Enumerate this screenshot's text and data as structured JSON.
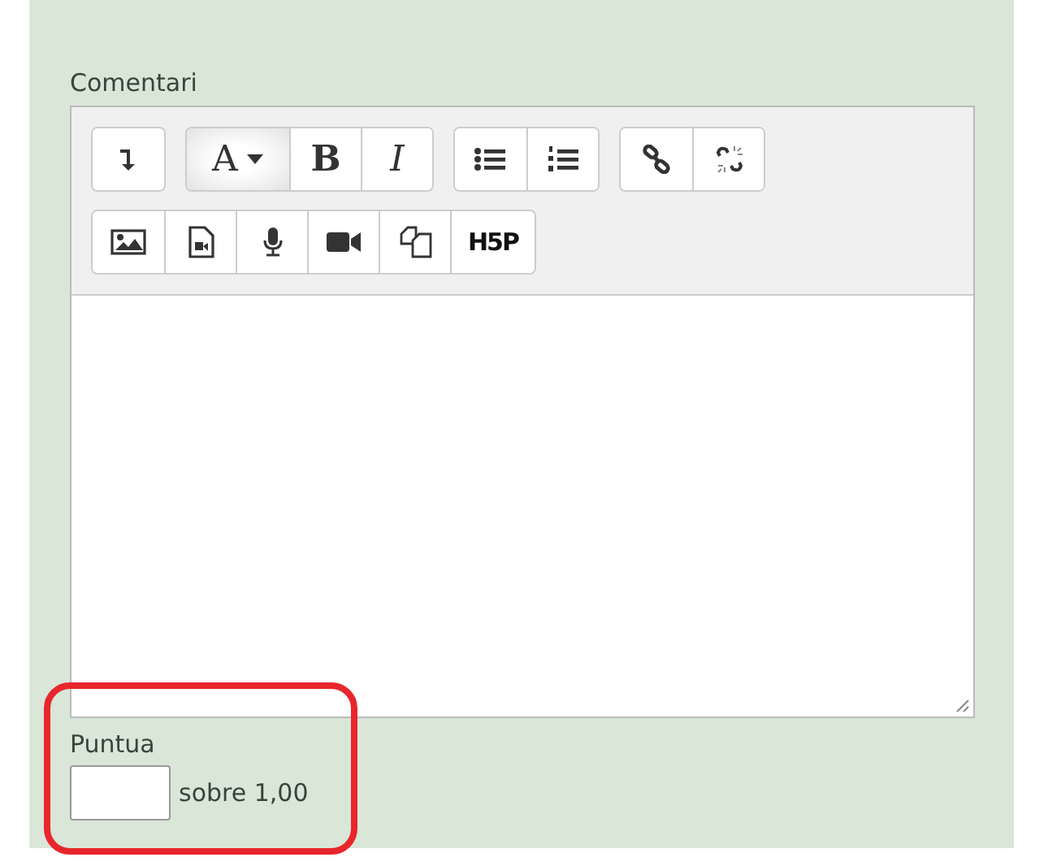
{
  "comment_field": {
    "label": "Comentari",
    "toolbar_rows": [
      [
        {
          "buttons": [
            {
              "kind": "icon",
              "selected": false
            }
          ]
        },
        {
          "buttons": [
            {
              "kind": "dropdown",
              "label": "A",
              "selected": true
            },
            {
              "kind": "bold",
              "label": "B",
              "selected": false
            },
            {
              "kind": "italic",
              "label": "I",
              "selected": false
            }
          ]
        },
        {
          "buttons": [
            {
              "kind": "icon",
              "selected": false
            },
            {
              "kind": "icon",
              "selected": false
            }
          ]
        },
        {
          "buttons": [
            {
              "kind": "icon",
              "selected": false
            },
            {
              "kind": "icon",
              "selected": false
            }
          ]
        }
      ],
      [
        {
          "buttons": [
            {
              "kind": "icon",
              "selected": false
            },
            {
              "kind": "icon",
              "selected": false
            },
            {
              "kind": "icon",
              "selected": false
            },
            {
              "kind": "icon",
              "selected": false
            },
            {
              "kind": "icon",
              "selected": false
            },
            {
              "kind": "logo",
              "label": "H5P",
              "selected": false
            }
          ]
        }
      ]
    ]
  },
  "grade": {
    "label": "Puntua",
    "suffix": "sobre 1,00"
  }
}
